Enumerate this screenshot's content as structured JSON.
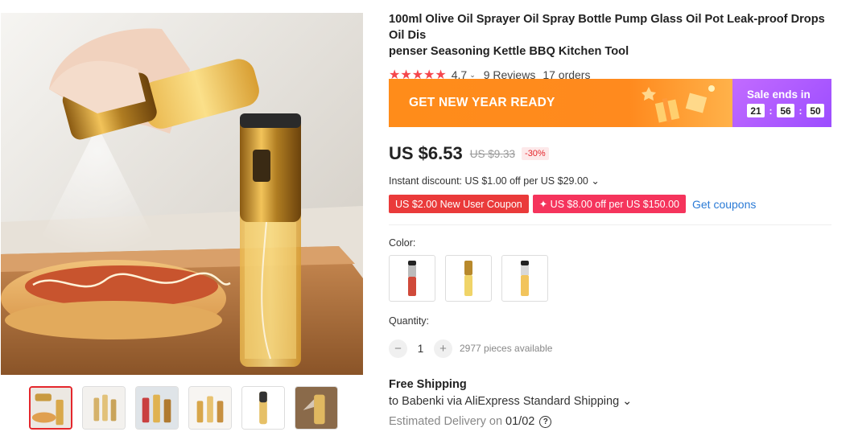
{
  "product": {
    "title": "100ml Olive Oil Sprayer Oil Spray Bottle Pump Glass Oil Pot Leak-proof Drops Oil Dispenser Seasoning Kettle BBQ Kitchen Tool",
    "title_line1": "100ml Olive Oil Sprayer Oil Spray Bottle Pump Glass Oil Pot Leak-proof Drops Oil Dis",
    "title_line2": "penser Seasoning Kettle BBQ Kitchen Tool"
  },
  "rating": {
    "stars": "★★★★★",
    "value": "4.7",
    "chevron": "⌄",
    "reviews": "9 Reviews",
    "orders": "17 orders"
  },
  "banner": {
    "text": "GET NEW YEAR READY",
    "sale_label": "Sale ends in",
    "timer": {
      "hours": "21",
      "minutes": "56",
      "seconds": "50",
      "sep": ":"
    },
    "colors": {
      "orange": "#ff8c1a",
      "purple": "#a855ff"
    }
  },
  "price": {
    "current": "US $6.53",
    "original": "US $9.33",
    "discount": "-30%"
  },
  "instant_discount": "Instant discount: US $1.00 off per US $29.00 ⌄",
  "coupons": {
    "new_user": "US $2.00 New User Coupon",
    "store": "✦ US $8.00 off per US $150.00",
    "get": "Get coupons"
  },
  "color": {
    "label": "Color:",
    "options": [
      "red-cap-bottle",
      "gold-bottle",
      "silver-cap-bottle"
    ]
  },
  "quantity": {
    "label": "Quantity:",
    "minus": "−",
    "value": "1",
    "plus": "+",
    "available": "2977 pieces available"
  },
  "shipping": {
    "title": "Free Shipping",
    "via": "to Babenki via AliExpress Standard Shipping ⌄",
    "delivery_label": "Estimated Delivery on",
    "delivery_date": "01/02",
    "help": "?"
  },
  "gallery": {
    "thumbnails": [
      "thumb-spray-hotdog",
      "thumb-bottles-cloth",
      "thumb-bottles-kitchen",
      "thumb-bottle-set",
      "thumb-gold-bottle",
      "thumb-spray-closeup"
    ],
    "active_index": 0
  }
}
